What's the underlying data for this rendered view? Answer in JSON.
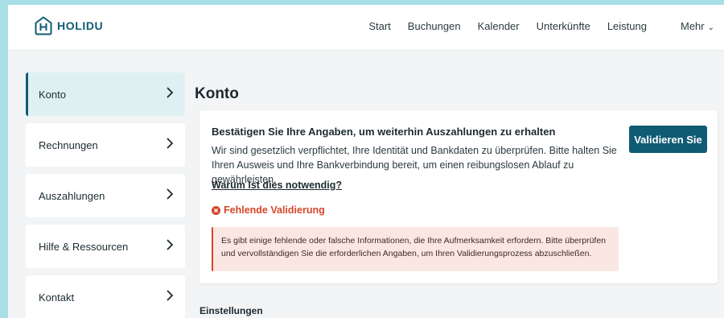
{
  "header": {
    "brand": "HOLIDU",
    "nav": [
      "Start",
      "Buchungen",
      "Kalender",
      "Unterkünfte",
      "Leistung",
      "Mehr"
    ],
    "more_chevron": "⌄"
  },
  "sidebar": {
    "items": [
      {
        "label": "Konto",
        "active": true
      },
      {
        "label": "Rechnungen",
        "active": false
      },
      {
        "label": "Auszahlungen",
        "active": false
      },
      {
        "label": "Hilfe & Ressourcen",
        "active": false
      },
      {
        "label": "Kontakt",
        "active": false
      }
    ]
  },
  "main": {
    "title": "Konto",
    "card": {
      "heading": "Bestätigen Sie Ihre Angaben, um weiterhin Auszahlungen zu erhalten",
      "body": "Wir sind gesetzlich verpflichtet, Ihre Identität und Bankdaten zu überprüfen. Bitte halten Sie Ihren Ausweis und Ihre Bankverbindung bereit, um einen reibungslosen Ablauf zu gewährleisten.",
      "link": "Warum ist dies notwendig?",
      "status": "Fehlende Validierung",
      "alert": "Es gibt einige fehlende oder falsche Informationen, die Ihre Aufmerksamkeit erfordern. Bitte überprüfen und vervollständigen Sie die erforderlichen Angaben, um Ihren Validierungsprozess abzuschließen.",
      "button": "Validieren Sie"
    },
    "section_title": "Einstellungen"
  },
  "icons": {
    "logo": "house-h-logo-icon",
    "arrow": "chevron-right-icon",
    "status": "error-circle-icon"
  },
  "colors": {
    "brand": "#0f5b73",
    "background_outer": "#a9dfe6",
    "page": "#f3f4f5",
    "error": "#d6452a",
    "alert_bg": "#fbe7e2",
    "active_item_bg": "#dff0f3"
  }
}
